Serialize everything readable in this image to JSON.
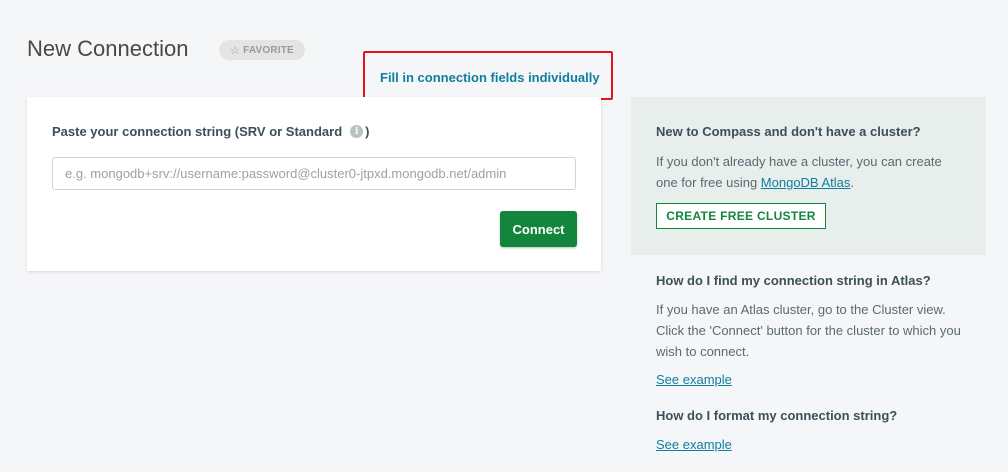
{
  "header": {
    "title": "New Connection",
    "favorite_label": "FAVORITE",
    "favorite_icon": "star-outline-icon"
  },
  "fill_fields_link": "Fill in connection fields individually",
  "connection_card": {
    "label": "Paste your connection string (SRV or Standard",
    "label_close": ")",
    "info_icon": "info-icon",
    "input_value": "",
    "input_placeholder": "e.g. mongodb+srv://username:password@cluster0-jtpxd.mongodb.net/admin",
    "connect_label": "Connect"
  },
  "sidebar": {
    "new_heading": "New to Compass and don't have a cluster?",
    "new_text": "If you don't already have a cluster, you can create one for free using ",
    "atlas_link": "MongoDB Atlas",
    "new_text_end": ".",
    "create_cluster_label": "CREATE FREE CLUSTER",
    "find_heading": "How do I find my connection string in Atlas?",
    "find_text": "If you have an Atlas cluster, go to the Cluster view. Click the 'Connect' button for the cluster to which you wish to connect.",
    "find_link": "See example",
    "format_heading": "How do I format my connection string?",
    "format_link": "See example"
  },
  "colors": {
    "accent_green": "#13853d",
    "link_blue": "#0e7fa0",
    "highlight_red": "#e0141e",
    "sidebar_bg": "#e7eeec"
  }
}
